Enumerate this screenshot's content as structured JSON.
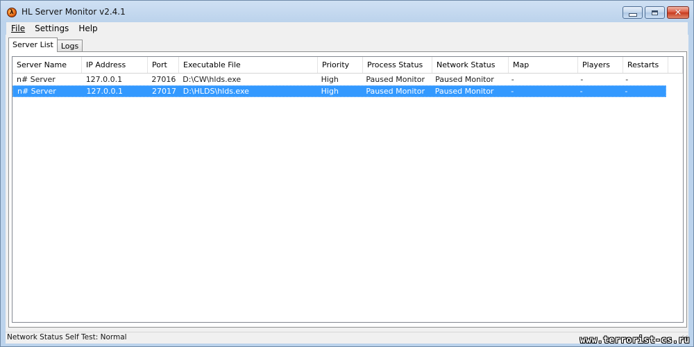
{
  "window": {
    "title": "HL Server Monitor v2.4.1",
    "icon": "hl-lambda-icon",
    "controls": {
      "minimize": "minimize-icon",
      "maximize": "maximize-icon",
      "close": "close-icon"
    }
  },
  "menu": [
    {
      "label": "File"
    },
    {
      "label": "Settings"
    },
    {
      "label": "Help"
    }
  ],
  "tabs": [
    {
      "label": "Server List",
      "active": true
    },
    {
      "label": "Logs",
      "active": false
    }
  ],
  "table": {
    "columns": [
      "Server Name",
      "IP Address",
      "Port",
      "Executable File",
      "Priority",
      "Process Status",
      "Network Status",
      "Map",
      "Players",
      "Restarts"
    ],
    "rows": [
      {
        "selected": false,
        "cells": [
          "n# Server",
          "127.0.0.1",
          "27016",
          "D:\\CW\\hlds.exe",
          "High",
          "Paused Monitor",
          "Paused Monitor",
          "-",
          "-",
          "-"
        ]
      },
      {
        "selected": true,
        "cells": [
          "n# Server",
          "127.0.0.1",
          "27017",
          "D:\\HLDS\\hlds.exe",
          "High",
          "Paused Monitor",
          "Paused Monitor",
          "-",
          "-",
          "-"
        ]
      }
    ]
  },
  "status_bar": {
    "text": "Network Status Self Test: Normal"
  },
  "watermark": "www.terrorist-cs.ru",
  "colors": {
    "selection": "#3399ff",
    "window_frame": "#bcd3ec",
    "close_button": "#c6391c"
  }
}
